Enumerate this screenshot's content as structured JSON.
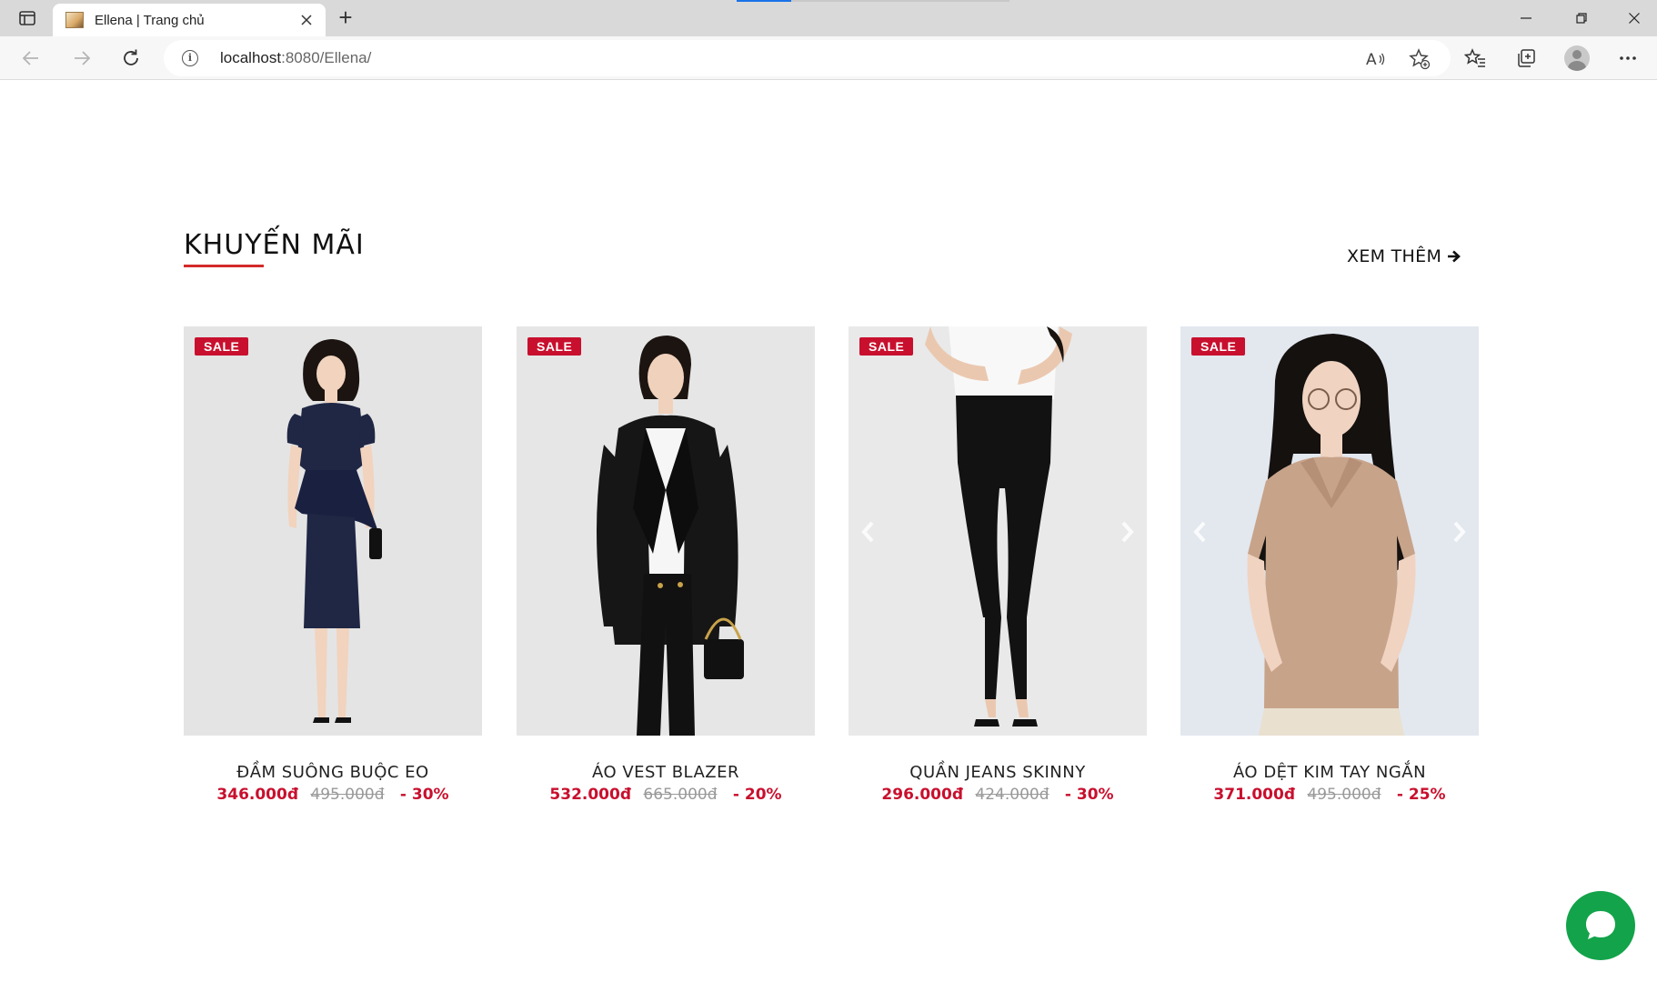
{
  "browser": {
    "tab_title": "Ellena | Trang chủ",
    "url_host": "localhost",
    "url_rest": ":8080/Ellena/"
  },
  "section": {
    "title": "KHUYẾN MÃI",
    "see_more": "XEM THÊM"
  },
  "accent_color": "#c8102e",
  "chat_color": "#13a34a",
  "products": [
    {
      "badge": "SALE",
      "name": "ĐẦM SUÔNG BUỘC EO",
      "price": "346.000đ",
      "old_price": "495.000đ",
      "discount": "- 30%",
      "image": "navy peplum dress model"
    },
    {
      "badge": "SALE",
      "name": "ÁO VEST BLAZER",
      "price": "532.000đ",
      "old_price": "665.000đ",
      "discount": "- 20%",
      "image": "black blazer and trousers model"
    },
    {
      "badge": "SALE",
      "name": "QUẦN JEANS SKINNY",
      "price": "296.000đ",
      "old_price": "424.000đ",
      "discount": "- 30%",
      "image": "black skinny jeans model"
    },
    {
      "badge": "SALE",
      "name": "ÁO DỆT KIM TAY NGẮN",
      "price": "371.000đ",
      "old_price": "495.000đ",
      "discount": "- 25%",
      "image": "beige knit polo top model"
    }
  ]
}
